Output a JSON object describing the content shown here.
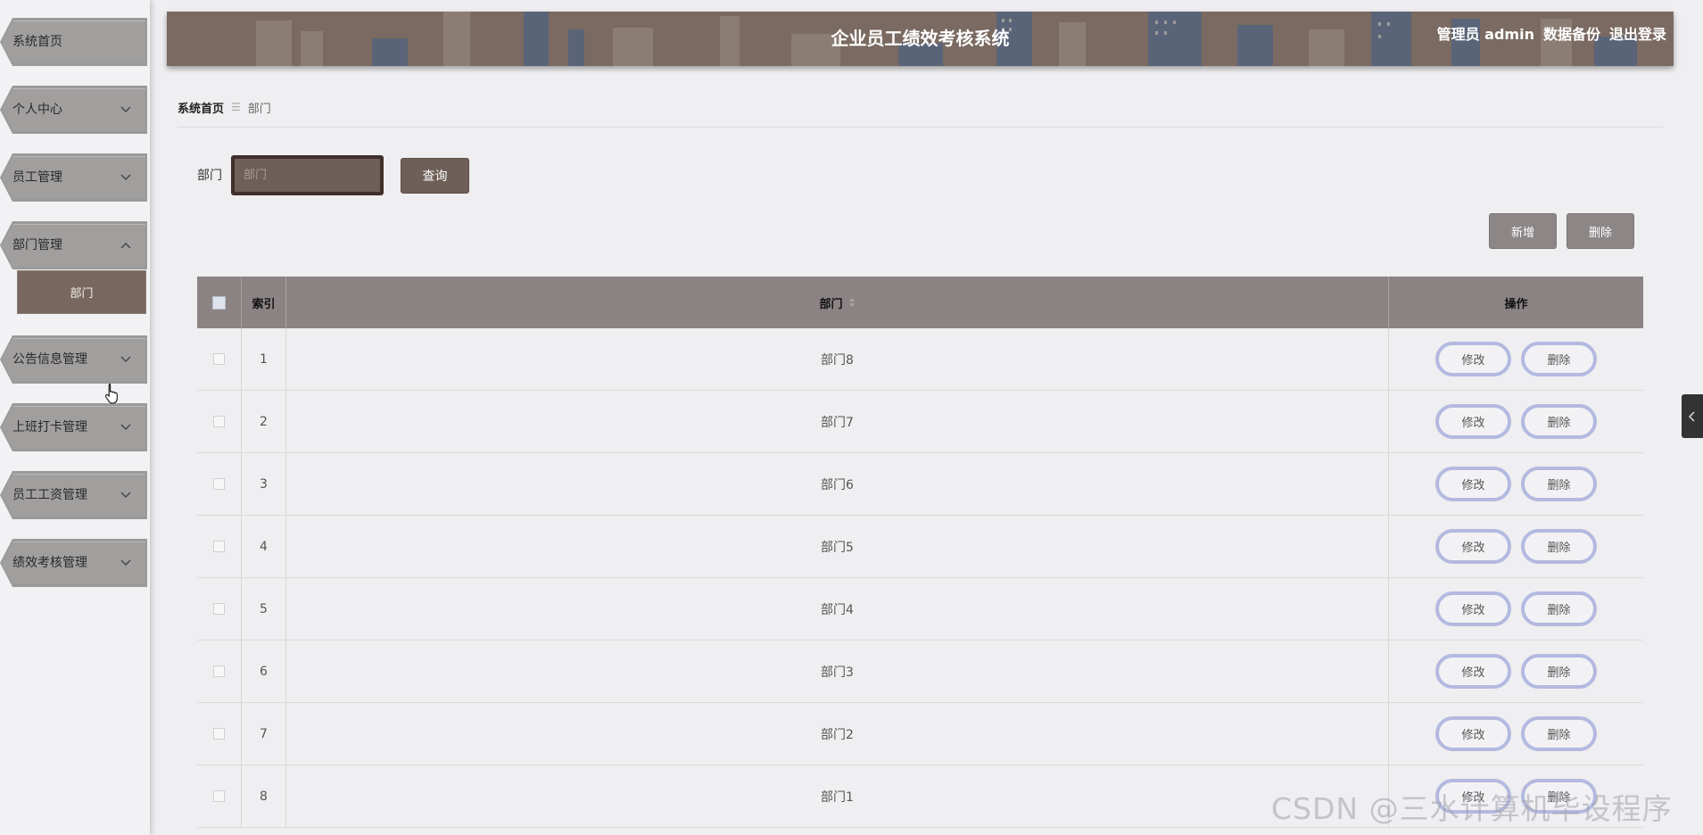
{
  "header": {
    "title": "企业员工绩效考核系统",
    "admin_label": "管理员 admin",
    "backup_label": "数据备份",
    "logout_label": "退出登录"
  },
  "sidebar": {
    "items": [
      {
        "label": "系统首页",
        "has_chevron": false
      },
      {
        "label": "个人中心",
        "chevron": "chevron-down-icon"
      },
      {
        "label": "员工管理",
        "chevron": "chevron-down-icon"
      },
      {
        "label": "部门管理",
        "chevron": "chevron-up-icon"
      },
      {
        "label": "公告信息管理",
        "chevron": "chevron-down-icon"
      },
      {
        "label": "上班打卡管理",
        "chevron": "chevron-down-icon"
      },
      {
        "label": "员工工资管理",
        "chevron": "chevron-down-icon"
      },
      {
        "label": "绩效考核管理",
        "chevron": "chevron-down-icon"
      }
    ],
    "active_subitem": "部门"
  },
  "breadcrumb": {
    "home": "系统首页",
    "current": "部门"
  },
  "search": {
    "label": "部门",
    "placeholder": "部门",
    "value": "",
    "query_button": "查询"
  },
  "actions": {
    "add_button": "新增",
    "delete_button": "删除"
  },
  "table": {
    "columns": [
      "索引",
      "部门",
      "操作"
    ],
    "rows": [
      {
        "index": "1",
        "dept": "部门8"
      },
      {
        "index": "2",
        "dept": "部门7"
      },
      {
        "index": "3",
        "dept": "部门6"
      },
      {
        "index": "4",
        "dept": "部门5"
      },
      {
        "index": "5",
        "dept": "部门4"
      },
      {
        "index": "6",
        "dept": "部门3"
      },
      {
        "index": "7",
        "dept": "部门2"
      },
      {
        "index": "8",
        "dept": "部门1"
      }
    ],
    "edit_label": "修改",
    "delete_label": "删除"
  },
  "watermark": "CSDN @三水计算机毕设程序",
  "colors": {
    "header_bg": "#7a6a61",
    "query_button": "#6e5f58",
    "table_header": "#8c8484",
    "op_button_border": "#b3b9e0"
  }
}
